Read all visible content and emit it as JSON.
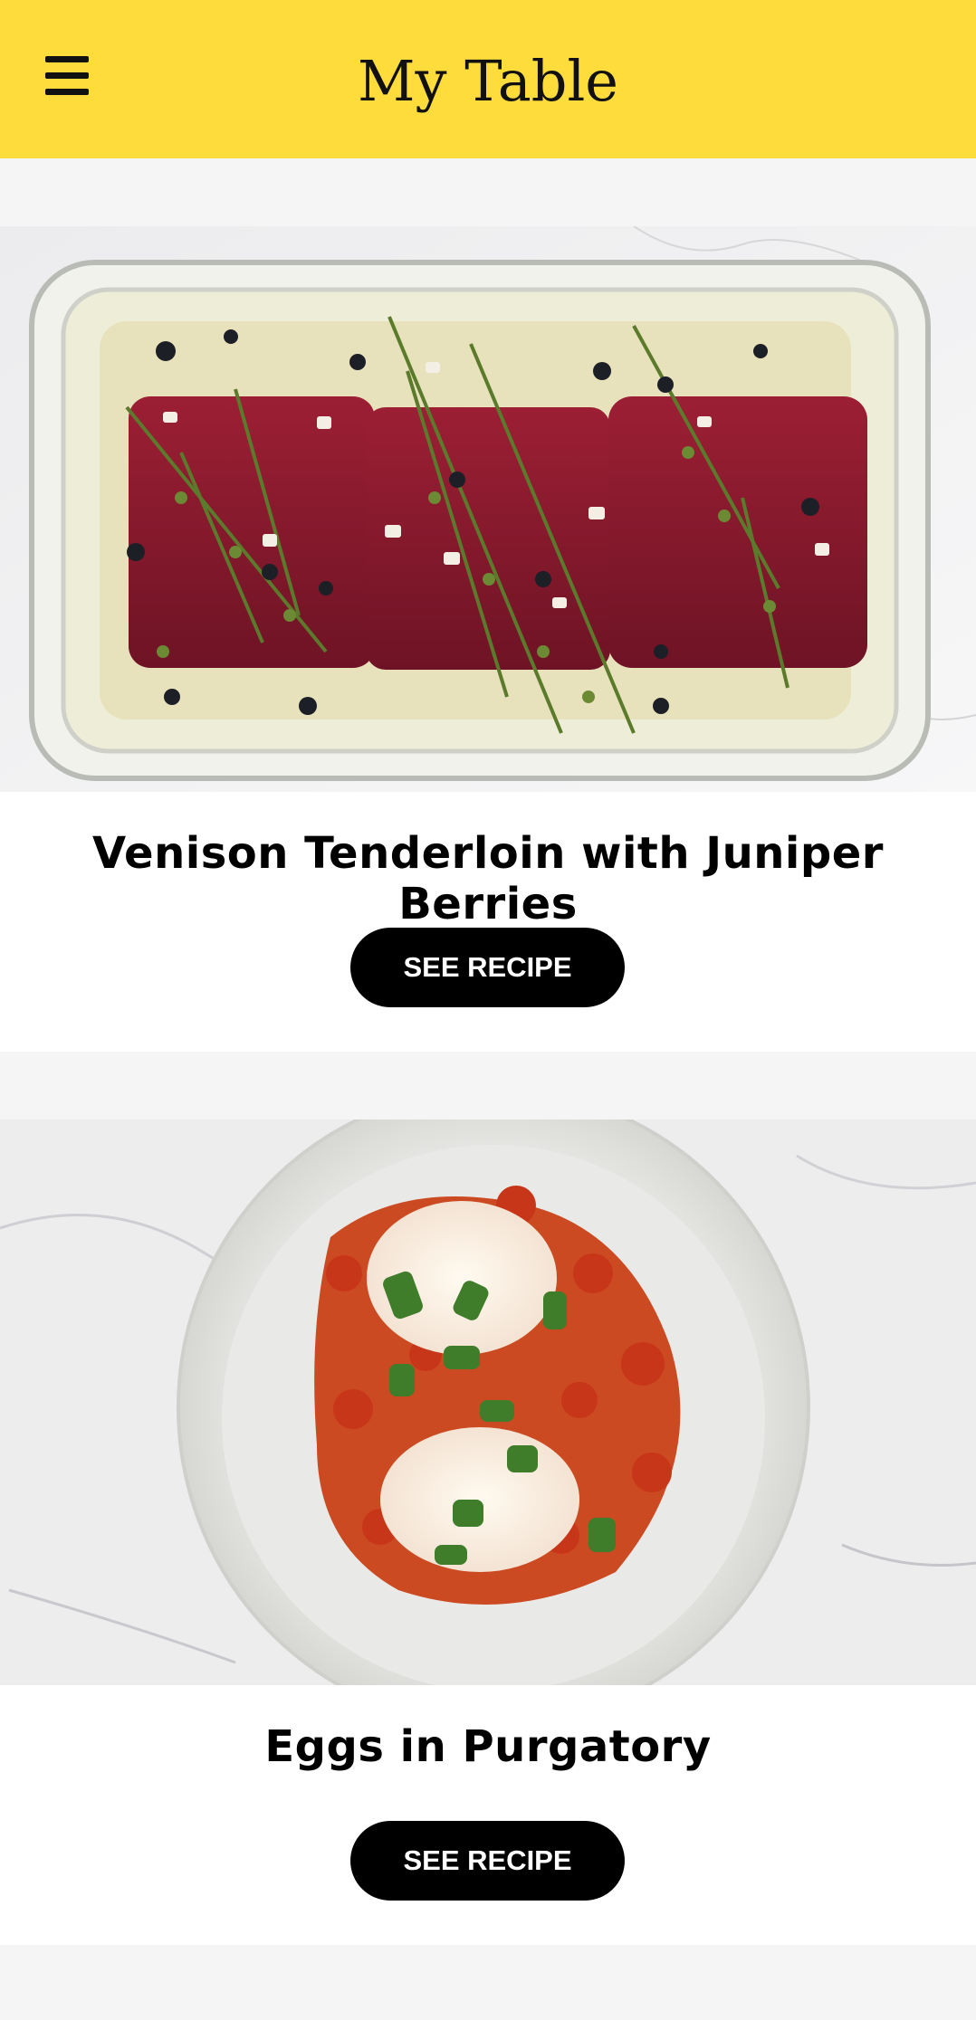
{
  "header": {
    "title": "My Table",
    "menu_icon": "hamburger-menu-icon",
    "background_color": "#fddc3c"
  },
  "recipes": [
    {
      "title": "Venison Tenderloin with Juniper Berries",
      "button_label": "SEE RECIPE"
    },
    {
      "title": "Eggs in Purgatory",
      "button_label": "SEE RECIPE"
    }
  ]
}
